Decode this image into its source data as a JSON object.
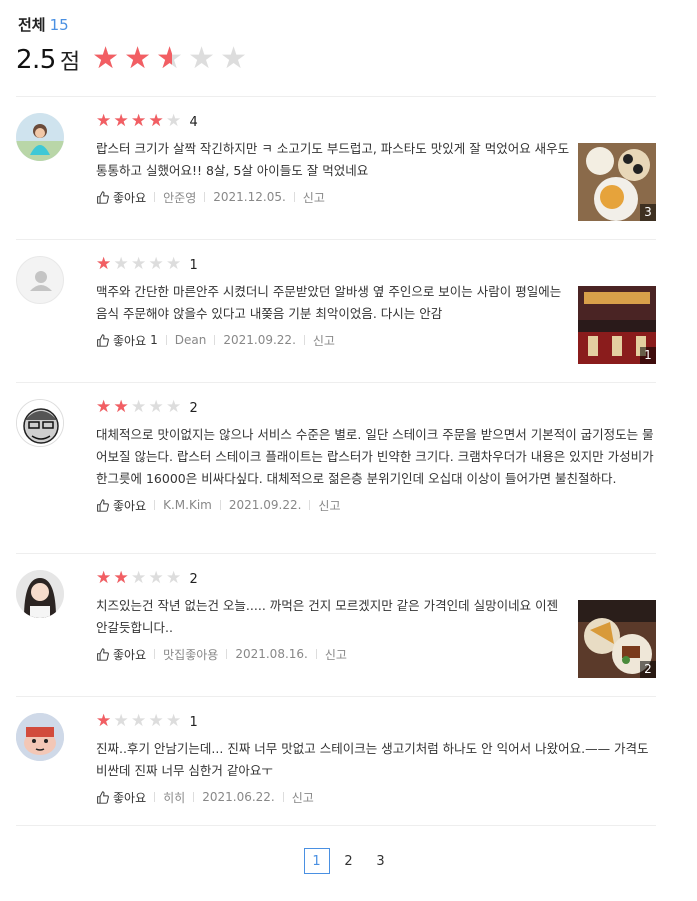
{
  "header": {
    "total_label": "전체",
    "total_count": "15",
    "score": "2.5",
    "score_unit": "점",
    "score_value": 2.5
  },
  "common": {
    "like_label": "좋아요",
    "report_label": "신고"
  },
  "reviews": [
    {
      "rating": 4,
      "rating_text": "4",
      "text": "랍스터 크기가 살짝 작긴하지만 ㅋ 소고기도 부드럽고, 파스타도 맛있게 잘 먹었어요 새우도 통통하고 실했어요!! 8살, 5살 아이들도 잘 먹었네요",
      "like_count": "",
      "author": "안준영",
      "date": "2021.12.05.",
      "photo_count": "3"
    },
    {
      "rating": 1,
      "rating_text": "1",
      "text": "맥주와 간단한 마른안주 시켰더니 주문받았던 알바생 옆 주인으로 보이는 사람이 평일에는 음식 주문해야 앉을수 있다고 내쫒음 기분 최악이었음. 다시는 안감",
      "like_count": "1",
      "author": "Dean",
      "date": "2021.09.22.",
      "photo_count": "1"
    },
    {
      "rating": 2,
      "rating_text": "2",
      "text": "대체적으로 맛이없지는 않으나 서비스 수준은 별로. 일단 스테이크 주문을 받으면서 기본적이 굽기정도는 물어보질 않는다. 랍스터 스테이크 플래이트는 랍스터가 빈약한 크기다. 크램차우더가 내용은 있지만 가성비가 한그릇에 16000은 비싸다싶다. 대체적으로 젊은층 분위기인데 오십대 이상이 들어가면 불친절하다.",
      "like_count": "",
      "author": "K.M.Kim",
      "date": "2021.09.22.",
      "photo_count": ""
    },
    {
      "rating": 2,
      "rating_text": "2",
      "text": "치즈있는건 작년 없는건 오늘..... 까먹은 건지 모르겠지만 같은 가격인데 실망이네요 이젠 안갈듯합니다..",
      "like_count": "",
      "author": "맛집좋아용",
      "date": "2021.08.16.",
      "photo_count": "2"
    },
    {
      "rating": 1,
      "rating_text": "1",
      "text": "진짜..후기 안남기는데... 진짜 너무 맛없고 스테이크는 생고기처럼 하나도 안 익어서 나왔어요.—— 가격도 비싼데 진짜 너무 심한거 같아요ㅜ",
      "like_count": "",
      "author": "히히",
      "date": "2021.06.22.",
      "photo_count": ""
    }
  ],
  "pagination": {
    "pages": [
      "1",
      "2",
      "3"
    ],
    "current": "1"
  },
  "colors": {
    "star_active": "#f25e63",
    "star_inactive": "#dddddd",
    "accent": "#4a90e2"
  },
  "icons": {
    "like": "thumbs-up-icon",
    "star": "star-icon"
  }
}
